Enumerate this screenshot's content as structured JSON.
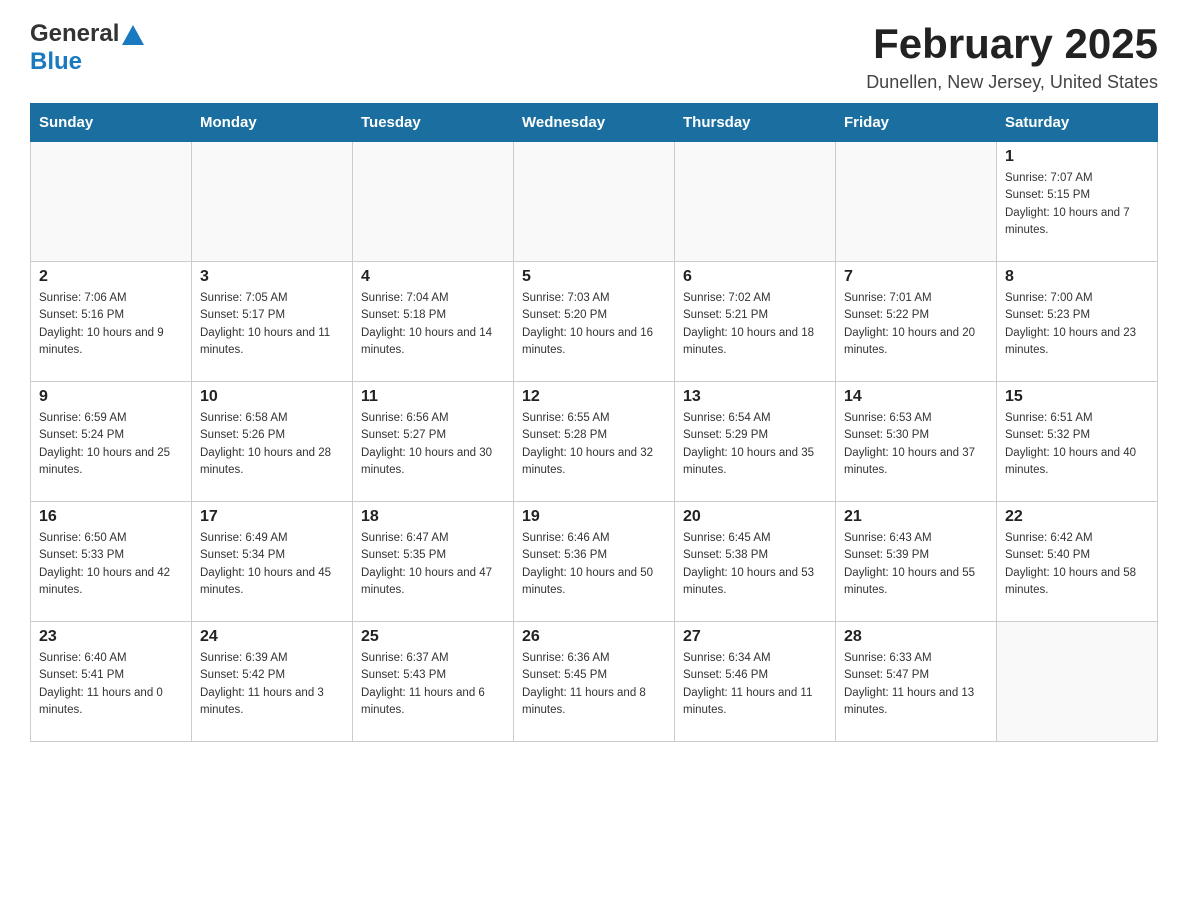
{
  "header": {
    "logo_line1": "General",
    "logo_line2": "Blue",
    "month_title": "February 2025",
    "location": "Dunellen, New Jersey, United States"
  },
  "weekdays": [
    "Sunday",
    "Monday",
    "Tuesday",
    "Wednesday",
    "Thursday",
    "Friday",
    "Saturday"
  ],
  "weeks": [
    [
      {
        "day": "",
        "info": ""
      },
      {
        "day": "",
        "info": ""
      },
      {
        "day": "",
        "info": ""
      },
      {
        "day": "",
        "info": ""
      },
      {
        "day": "",
        "info": ""
      },
      {
        "day": "",
        "info": ""
      },
      {
        "day": "1",
        "info": "Sunrise: 7:07 AM\nSunset: 5:15 PM\nDaylight: 10 hours and 7 minutes."
      }
    ],
    [
      {
        "day": "2",
        "info": "Sunrise: 7:06 AM\nSunset: 5:16 PM\nDaylight: 10 hours and 9 minutes."
      },
      {
        "day": "3",
        "info": "Sunrise: 7:05 AM\nSunset: 5:17 PM\nDaylight: 10 hours and 11 minutes."
      },
      {
        "day": "4",
        "info": "Sunrise: 7:04 AM\nSunset: 5:18 PM\nDaylight: 10 hours and 14 minutes."
      },
      {
        "day": "5",
        "info": "Sunrise: 7:03 AM\nSunset: 5:20 PM\nDaylight: 10 hours and 16 minutes."
      },
      {
        "day": "6",
        "info": "Sunrise: 7:02 AM\nSunset: 5:21 PM\nDaylight: 10 hours and 18 minutes."
      },
      {
        "day": "7",
        "info": "Sunrise: 7:01 AM\nSunset: 5:22 PM\nDaylight: 10 hours and 20 minutes."
      },
      {
        "day": "8",
        "info": "Sunrise: 7:00 AM\nSunset: 5:23 PM\nDaylight: 10 hours and 23 minutes."
      }
    ],
    [
      {
        "day": "9",
        "info": "Sunrise: 6:59 AM\nSunset: 5:24 PM\nDaylight: 10 hours and 25 minutes."
      },
      {
        "day": "10",
        "info": "Sunrise: 6:58 AM\nSunset: 5:26 PM\nDaylight: 10 hours and 28 minutes."
      },
      {
        "day": "11",
        "info": "Sunrise: 6:56 AM\nSunset: 5:27 PM\nDaylight: 10 hours and 30 minutes."
      },
      {
        "day": "12",
        "info": "Sunrise: 6:55 AM\nSunset: 5:28 PM\nDaylight: 10 hours and 32 minutes."
      },
      {
        "day": "13",
        "info": "Sunrise: 6:54 AM\nSunset: 5:29 PM\nDaylight: 10 hours and 35 minutes."
      },
      {
        "day": "14",
        "info": "Sunrise: 6:53 AM\nSunset: 5:30 PM\nDaylight: 10 hours and 37 minutes."
      },
      {
        "day": "15",
        "info": "Sunrise: 6:51 AM\nSunset: 5:32 PM\nDaylight: 10 hours and 40 minutes."
      }
    ],
    [
      {
        "day": "16",
        "info": "Sunrise: 6:50 AM\nSunset: 5:33 PM\nDaylight: 10 hours and 42 minutes."
      },
      {
        "day": "17",
        "info": "Sunrise: 6:49 AM\nSunset: 5:34 PM\nDaylight: 10 hours and 45 minutes."
      },
      {
        "day": "18",
        "info": "Sunrise: 6:47 AM\nSunset: 5:35 PM\nDaylight: 10 hours and 47 minutes."
      },
      {
        "day": "19",
        "info": "Sunrise: 6:46 AM\nSunset: 5:36 PM\nDaylight: 10 hours and 50 minutes."
      },
      {
        "day": "20",
        "info": "Sunrise: 6:45 AM\nSunset: 5:38 PM\nDaylight: 10 hours and 53 minutes."
      },
      {
        "day": "21",
        "info": "Sunrise: 6:43 AM\nSunset: 5:39 PM\nDaylight: 10 hours and 55 minutes."
      },
      {
        "day": "22",
        "info": "Sunrise: 6:42 AM\nSunset: 5:40 PM\nDaylight: 10 hours and 58 minutes."
      }
    ],
    [
      {
        "day": "23",
        "info": "Sunrise: 6:40 AM\nSunset: 5:41 PM\nDaylight: 11 hours and 0 minutes."
      },
      {
        "day": "24",
        "info": "Sunrise: 6:39 AM\nSunset: 5:42 PM\nDaylight: 11 hours and 3 minutes."
      },
      {
        "day": "25",
        "info": "Sunrise: 6:37 AM\nSunset: 5:43 PM\nDaylight: 11 hours and 6 minutes."
      },
      {
        "day": "26",
        "info": "Sunrise: 6:36 AM\nSunset: 5:45 PM\nDaylight: 11 hours and 8 minutes."
      },
      {
        "day": "27",
        "info": "Sunrise: 6:34 AM\nSunset: 5:46 PM\nDaylight: 11 hours and 11 minutes."
      },
      {
        "day": "28",
        "info": "Sunrise: 6:33 AM\nSunset: 5:47 PM\nDaylight: 11 hours and 13 minutes."
      },
      {
        "day": "",
        "info": ""
      }
    ]
  ]
}
